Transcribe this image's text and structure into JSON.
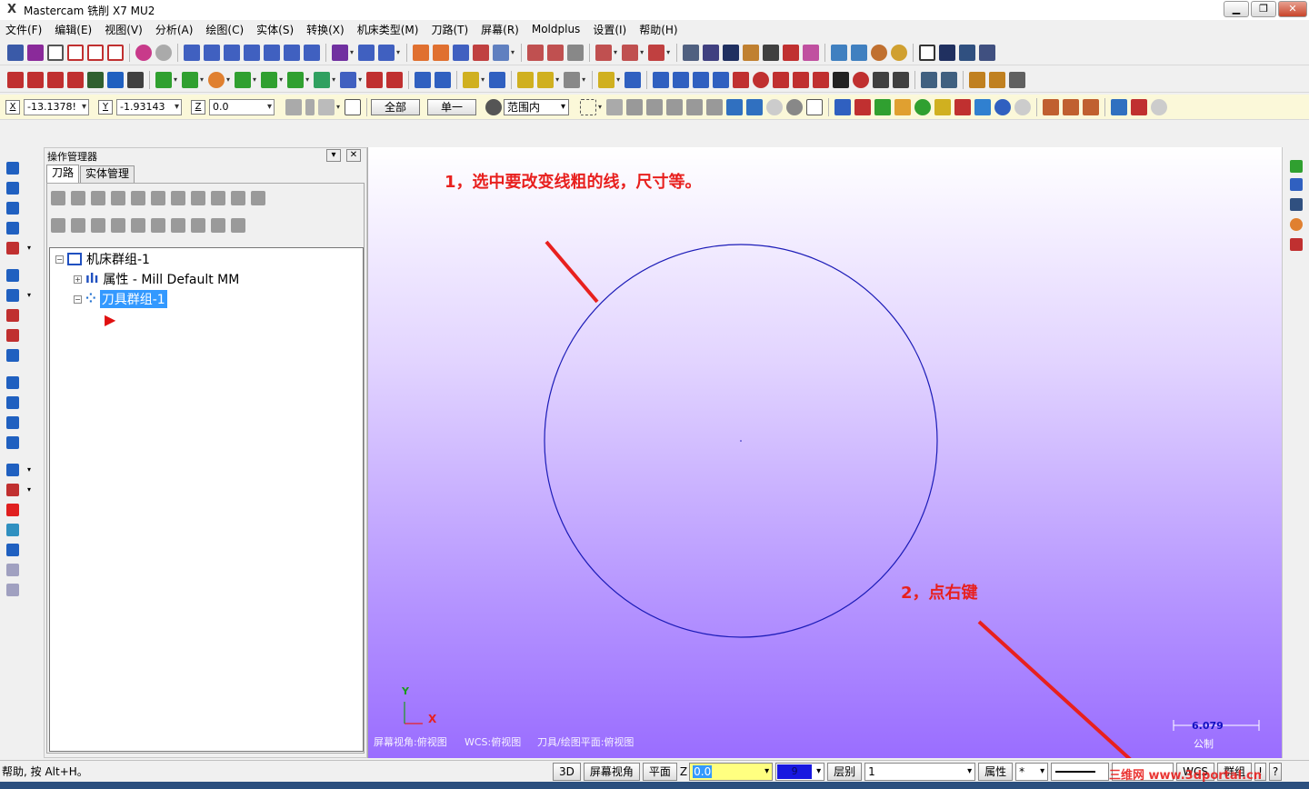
{
  "window": {
    "title": "Mastercam 铣削 X7 MU2"
  },
  "menu": [
    "文件(F)",
    "编辑(E)",
    "视图(V)",
    "分析(A)",
    "绘图(C)",
    "实体(S)",
    "转换(X)",
    "机床类型(M)",
    "刀路(T)",
    "屏幕(R)",
    "Moldplus",
    "设置(I)",
    "帮助(H)"
  ],
  "coords": {
    "x_label": "X",
    "x_value": "-13.1378!",
    "y_label": "Y",
    "y_value": "-1.93143",
    "z_label": "Z",
    "z_value": "0.0"
  },
  "selection": {
    "all_label": "全部",
    "single_label": "单一",
    "range_value": "范围内"
  },
  "ops_manager": {
    "title": "操作管理器",
    "tabs": [
      "刀路",
      "实体管理"
    ],
    "tree": {
      "root": "机床群组-1",
      "properties": "属性 - Mill Default MM",
      "toolgroup": "刀具群组-1"
    }
  },
  "viewport": {
    "annotation1": "1，选中要改变线粗的线，尺寸等。",
    "annotation2": "2，点右键",
    "axis_x": "X",
    "axis_y": "Y",
    "footer": [
      "屏幕视角:俯视图",
      "WCS:俯视图",
      "刀具/绘图平面:俯视图"
    ],
    "scale_value": "6.079",
    "scale_unit": "公制"
  },
  "status": {
    "help": "帮助, 按 Alt+H。",
    "btn_3d": "3D",
    "btn_screen_view": "屏幕视角",
    "btn_plane": "平面",
    "z_label": "Z",
    "z_value": "0.0",
    "color_value": "9",
    "level_label": "层别",
    "level_value": "1",
    "attr_label": "属性",
    "point_style": "*",
    "wcs_label": "WCS",
    "group_label": "群组",
    "help_btn": "!",
    "q_btn": "?"
  },
  "watermark": "三维网 www.3dportal.cn",
  "colors": {
    "circle": "#1c1cb8",
    "annotation": "#e8201e",
    "viewport_top": "#ffffff",
    "viewport_bottom": "#9a6dff",
    "selection": "#3399ff"
  }
}
